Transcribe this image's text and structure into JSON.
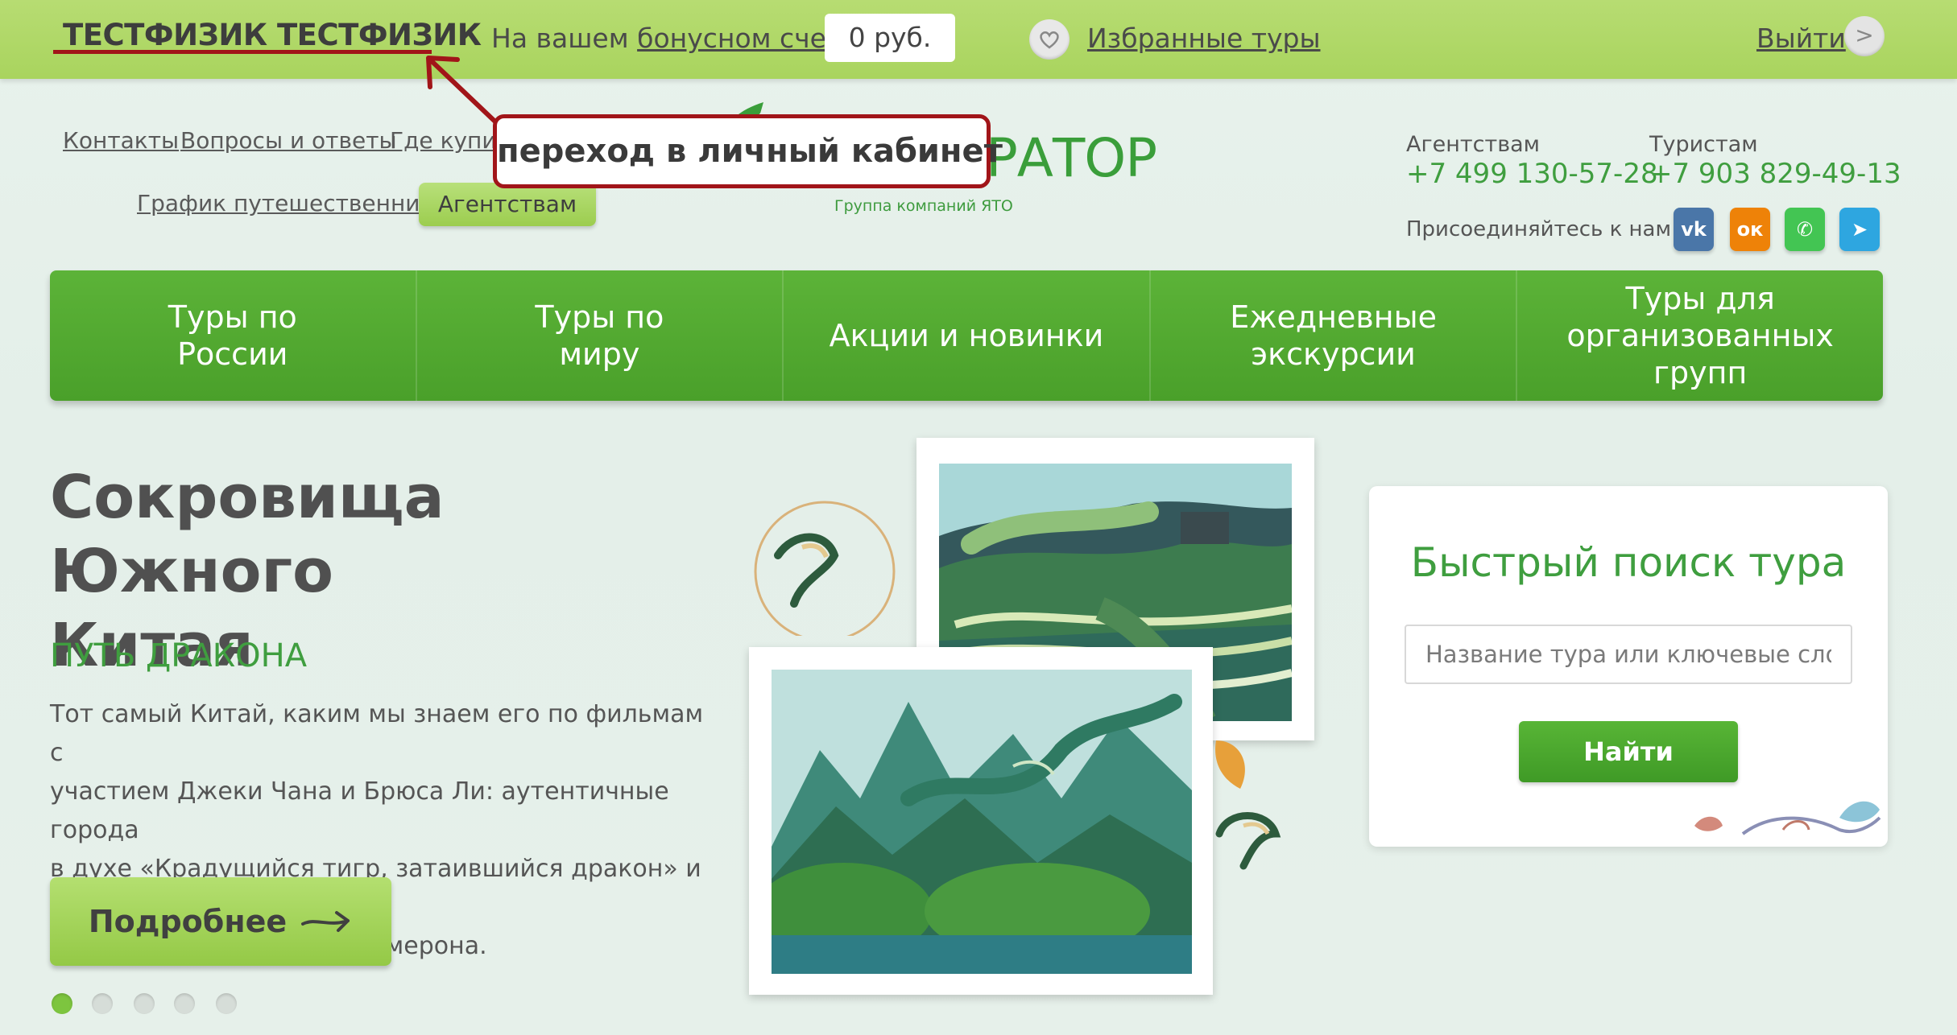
{
  "topbar": {
    "user_name": "ТЕСТФИЗИК ТЕСТФИЗИК",
    "bonus_prefix": "На вашем ",
    "bonus_link": "бонусном счету",
    "bonus_amount": "0 руб.",
    "favorites": "Избранные туры",
    "logout": "Выйти",
    "logout_icon": ">"
  },
  "callout": "переход в личный кабинет",
  "header_links": {
    "contacts": "Контакты",
    "faq": "Вопросы и ответы",
    "where_buy": "Где купить",
    "schedule": "График путешественника",
    "agency_button": "Агентствам"
  },
  "logo": {
    "text": "РАТОР",
    "subtitle": "Группа компаний ЯТО"
  },
  "contacts": {
    "agency_label": "Агентствам",
    "agency_phone": "+7 499 130-57-28",
    "tourist_label": "Туристам",
    "tourist_phone": "+7 903 829-49-13",
    "join_label": "Присоединяйтесь к нам:"
  },
  "social": [
    {
      "name": "vk",
      "glyph": "vk",
      "color": "#4a76a8"
    },
    {
      "name": "ok",
      "glyph": "ок",
      "color": "#ee8208"
    },
    {
      "name": "whatsapp",
      "glyph": "✆",
      "color": "#43c553"
    },
    {
      "name": "telegram",
      "glyph": "➤",
      "color": "#2ea6e0"
    }
  ],
  "nav": [
    {
      "line1": "Туры по",
      "line2": "России"
    },
    {
      "line1": "Туры по",
      "line2": "миру"
    },
    {
      "line1": "Акции и новинки",
      "line2": ""
    },
    {
      "line1": "Ежедневные",
      "line2": "экскурсии"
    },
    {
      "line1": "Туры для",
      "line2": "организованных групп"
    }
  ],
  "hero": {
    "title_line1": "Сокровища Южного",
    "title_line2": "Китая",
    "subtitle": "ПУТЬ ДРАКОНА",
    "desc_line1": "Тот самый Китай, каким мы знаем его по фильмам с",
    "desc_line2": "участием Джеки Чана и Брюса Ли: аутентичные города",
    "desc_line3": "в духе «Крадущийся тигр, затаившийся дракон» и горы",
    "desc_line4": "«Аватара» от Джеймса Камерона.",
    "more_button": "Подробнее",
    "slides_total": 5,
    "slide_active": 1
  },
  "quick_search": {
    "title": "Быстрый поиск тура",
    "placeholder": "Название тура или ключевые слова",
    "button": "Найти"
  },
  "colors": {
    "topbar": "#b1d869",
    "nav": "#52aa31",
    "accent_green": "#3f9e3f",
    "callout_border": "#a11519"
  }
}
